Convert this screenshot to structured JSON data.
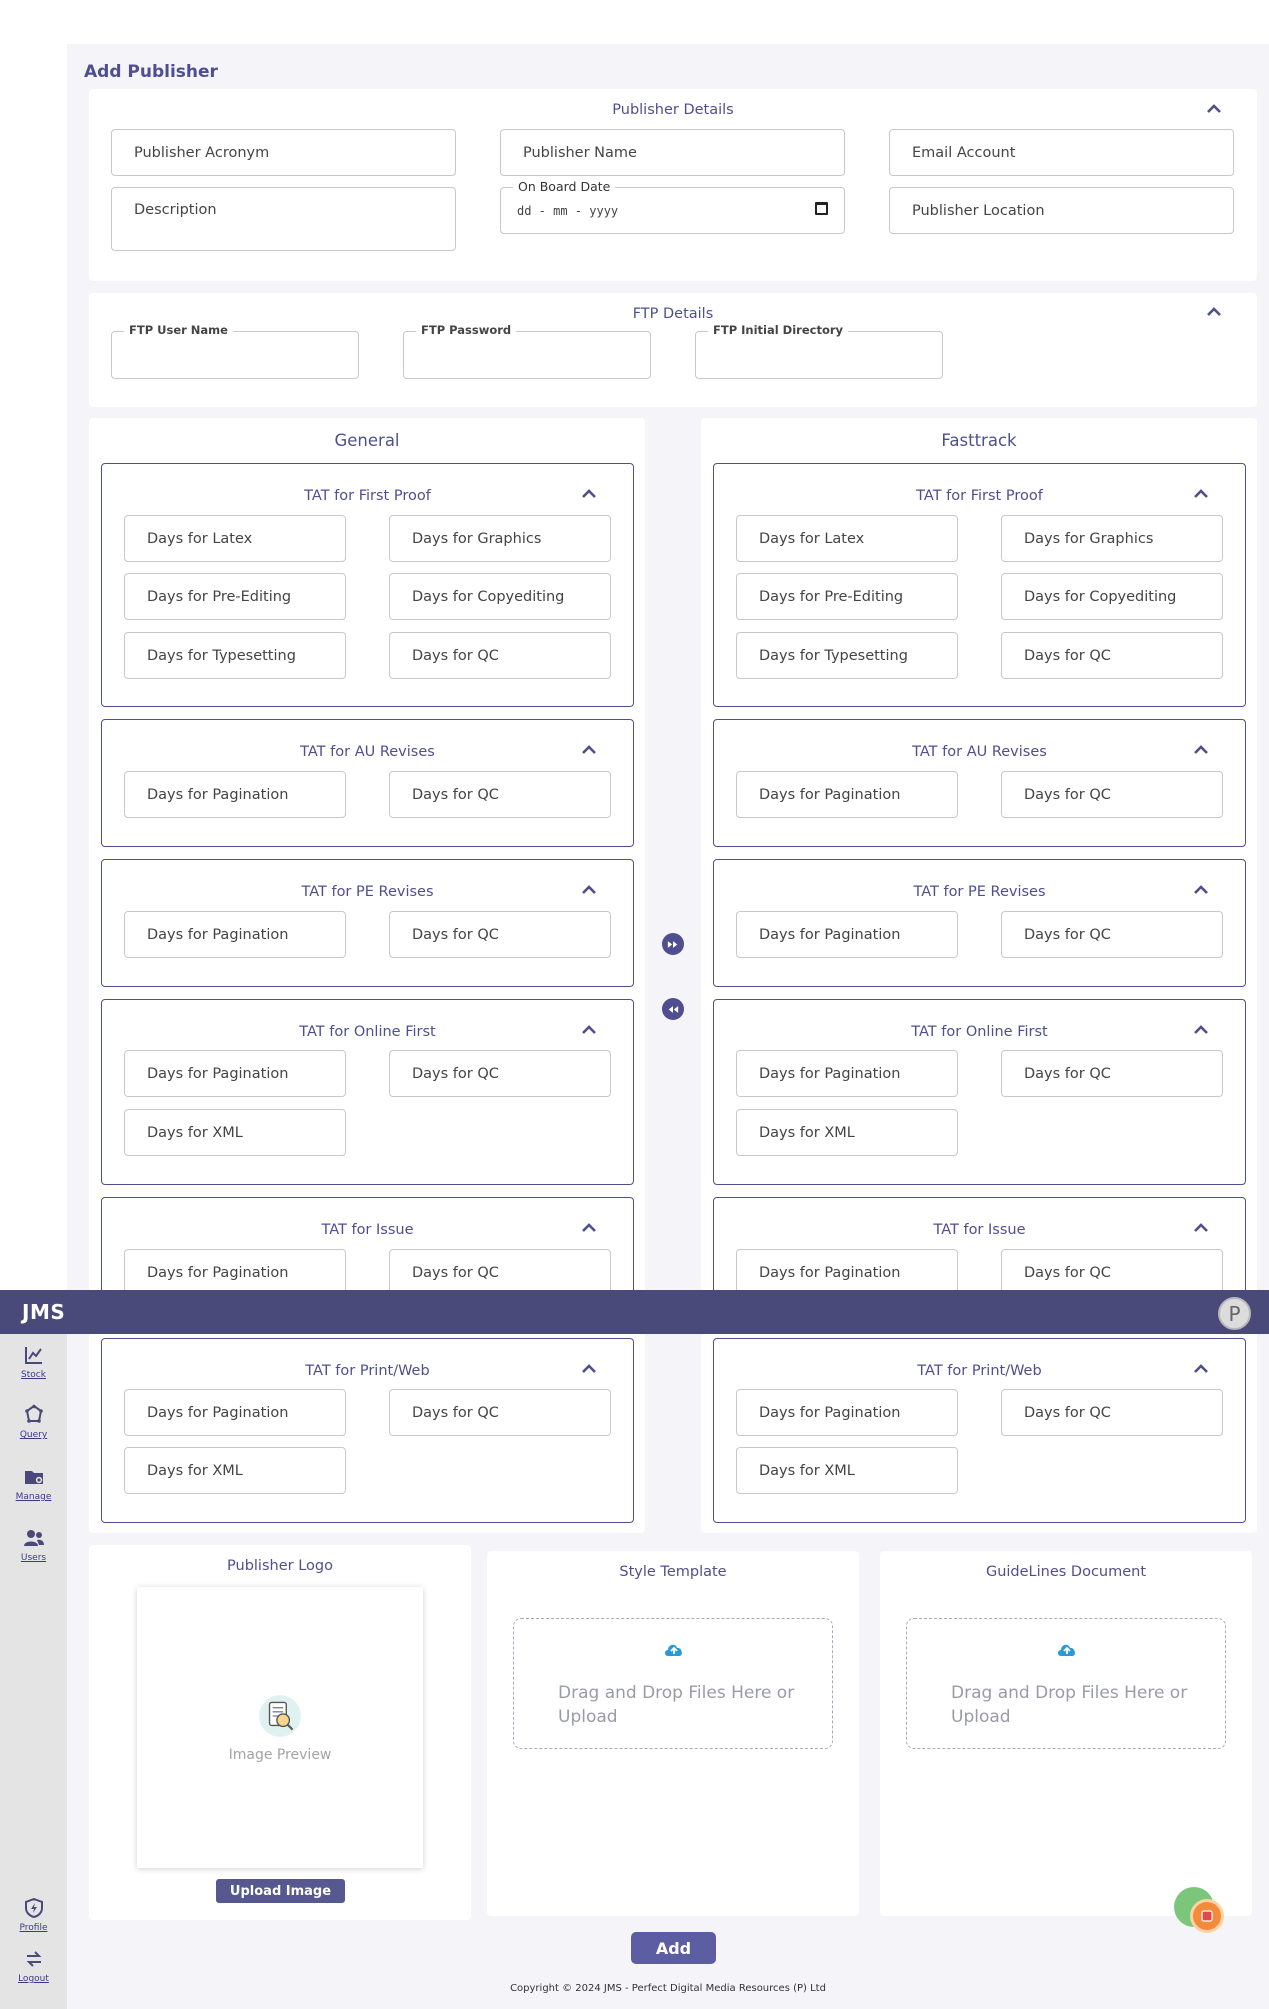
{
  "app": {
    "logo": "JMS",
    "avatar_initial": "P"
  },
  "page": {
    "title": "Add Publisher"
  },
  "publisher_details": {
    "title": "Publisher Details",
    "acronym_placeholder": "Publisher Acronym",
    "name_placeholder": "Publisher Name",
    "email_placeholder": "Email Account",
    "description_placeholder": "Description",
    "onboard_label": "On Board Date",
    "onboard_value": "dd - mm - yyyy",
    "location_placeholder": "Publisher Location"
  },
  "ftp_details": {
    "title": "FTP Details",
    "user_label": "FTP User Name",
    "password_label": "FTP Password",
    "directory_label": "FTP Initial Directory"
  },
  "general": {
    "title": "General",
    "first_proof": {
      "title": "TAT for First Proof",
      "f1": "Days for Latex",
      "f2": "Days for Graphics",
      "f3": "Days for Pre-Editing",
      "f4": "Days for Copyediting",
      "f5": "Days for Typesetting",
      "f6": "Days for QC"
    },
    "au_revises": {
      "title": "TAT for AU Revises",
      "f1": "Days for Pagination",
      "f2": "Days for QC"
    },
    "pe_revises": {
      "title": "TAT for PE Revises",
      "f1": "Days for Pagination",
      "f2": "Days for QC"
    },
    "online_first": {
      "title": "TAT for Online First",
      "f1": "Days for Pagination",
      "f2": "Days for QC",
      "f3": "Days for XML"
    },
    "issue": {
      "title": "TAT for Issue",
      "f1": "Days for Pagination",
      "f2": "Days for QC"
    },
    "print_web": {
      "title": "TAT for Print/Web",
      "f1": "Days for Pagination",
      "f2": "Days for QC",
      "f3": "Days for XML"
    }
  },
  "fasttrack": {
    "title": "Fasttrack",
    "first_proof": {
      "title": "TAT for First Proof",
      "f1": "Days for Latex",
      "f2": "Days for Graphics",
      "f3": "Days for Pre-Editing",
      "f4": "Days for Copyediting",
      "f5": "Days for Typesetting",
      "f6": "Days for QC"
    },
    "au_revises": {
      "title": "TAT for AU Revises",
      "f1": "Days for Pagination",
      "f2": "Days for QC"
    },
    "pe_revises": {
      "title": "TAT for PE Revises",
      "f1": "Days for Pagination",
      "f2": "Days for QC"
    },
    "online_first": {
      "title": "TAT for Online First",
      "f1": "Days for Pagination",
      "f2": "Days for QC",
      "f3": "Days for XML"
    },
    "issue": {
      "title": "TAT for Issue",
      "f1": "Days for Pagination",
      "f2": "Days for QC"
    },
    "print_web": {
      "title": "TAT for Print/Web",
      "f1": "Days for Pagination",
      "f2": "Days for QC",
      "f3": "Days for XML"
    }
  },
  "sidebar": {
    "items": [
      {
        "label": "Stock",
        "icon": "chart-icon"
      },
      {
        "label": "Query",
        "icon": "query-icon"
      },
      {
        "label": "Manage",
        "icon": "folder-icon"
      },
      {
        "label": "Users",
        "icon": "users-icon"
      }
    ],
    "bottom": [
      {
        "label": "Profile",
        "icon": "profile-icon"
      },
      {
        "label": "Logout",
        "icon": "logout-icon"
      }
    ]
  },
  "uploads": {
    "logo_title": "Publisher Logo",
    "preview_text": "Image Preview",
    "upload_button": "Upload Image",
    "style_title": "Style Template",
    "guidelines_title": "GuideLines Document",
    "drop_text": "Drag and Drop Files Here or Upload"
  },
  "actions": {
    "add": "Add"
  },
  "footer": {
    "copyright": "Copyright © 2024 JMS - Perfect Digital Media Resources (P) Ltd"
  },
  "colors": {
    "accent": "#4f4f8f",
    "topbar": "#494a7a",
    "background": "#f4f4f9"
  }
}
